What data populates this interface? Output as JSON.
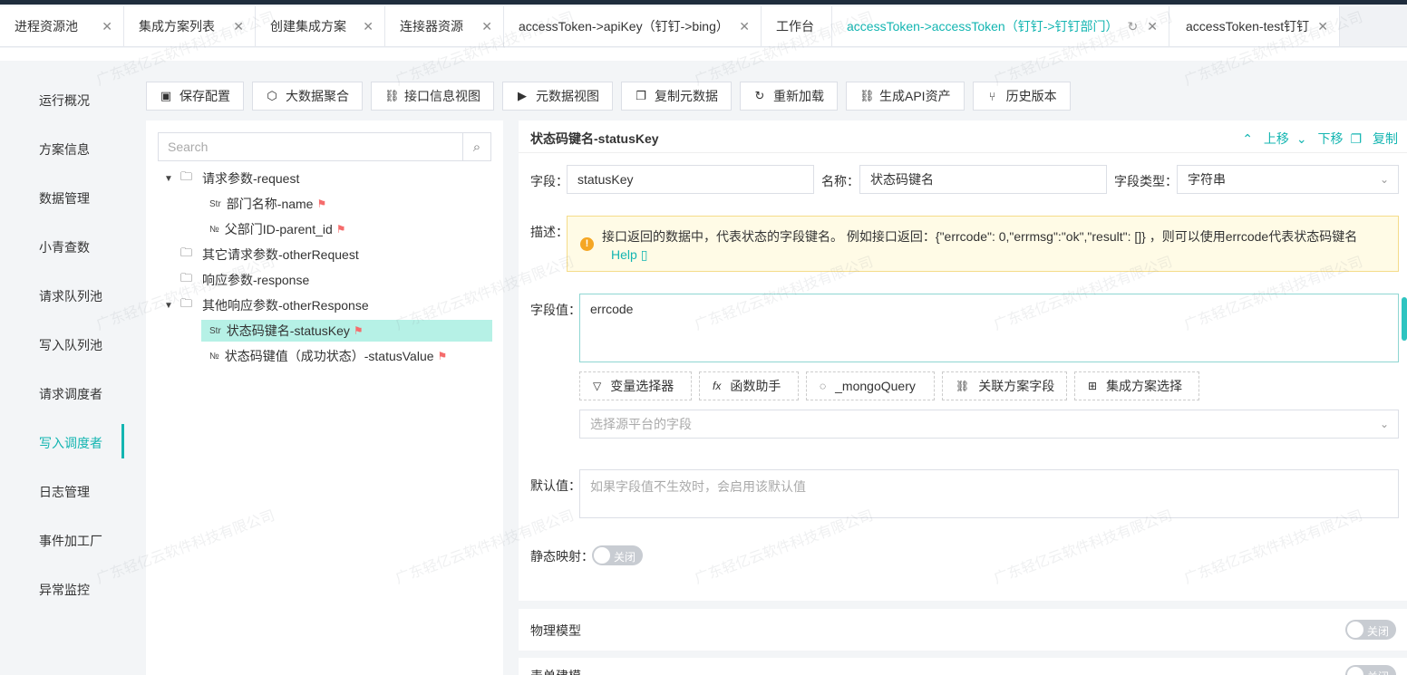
{
  "tabs": [
    {
      "label": "进程资源池",
      "active": false
    },
    {
      "label": "集成方案列表",
      "active": false
    },
    {
      "label": "创建集成方案",
      "active": false
    },
    {
      "label": "连接器资源",
      "active": false
    },
    {
      "label": "accessToken->apiKey（钉钉->bing）",
      "active": false
    },
    {
      "label": "工作台",
      "active": false
    },
    {
      "label": "accessToken->accessToken（钉钉->钉钉部门）",
      "active": true
    },
    {
      "label": "accessToken-test钉钉",
      "active": false
    }
  ],
  "sidebar": {
    "items": [
      "运行概况",
      "方案信息",
      "数据管理",
      "小青查数",
      "请求队列池",
      "写入队列池",
      "请求调度者",
      "写入调度者",
      "日志管理",
      "事件加工厂",
      "异常监控"
    ],
    "active": "写入调度者"
  },
  "toolbar": {
    "save": "保存配置",
    "bigdata": "大数据聚合",
    "api_view": "接口信息视图",
    "meta_view": "元数据视图",
    "copy_meta": "复制元数据",
    "reload": "重新加载",
    "gen_api": "生成API资产",
    "history": "历史版本"
  },
  "tree": {
    "search_placeholder": "Search",
    "nodes": {
      "request": "请求参数-request",
      "name": "部门名称-name",
      "parent_id": "父部门ID-parent_id",
      "other_request": "其它请求参数-otherRequest",
      "response": "响应参数-response",
      "other_response": "其他响应参数-otherResponse",
      "status_key": "状态码键名-statusKey",
      "status_value": "状态码键值（成功状态）-statusValue"
    },
    "type_str": "Str",
    "type_num": "№"
  },
  "form": {
    "title": "状态码键名-statusKey",
    "actions": {
      "up": "上移",
      "down": "下移",
      "copy": "复制"
    },
    "field_label": "字段：",
    "field_value": "statusKey",
    "name_label": "名称：",
    "name_value": "状态码键名",
    "type_label": "字段类型：",
    "type_value": "字符串",
    "desc_label": "描述：",
    "desc_text": "接口返回的数据中，代表状态的字段键名。 例如接口返回：{\"errcode\": 0,\"errmsg\":\"ok\",\"result\": []} ，则可以使用errcode代表状态码键名",
    "help": "Help",
    "value_label": "字段值：",
    "value_text": "errcode",
    "buttons": {
      "var": "变量选择器",
      "func": "函数助手",
      "mongo": "_mongoQuery",
      "link": "关联方案字段",
      "scheme": "集成方案选择"
    },
    "source_placeholder": "选择源平台的字段",
    "default_label": "默认值：",
    "default_placeholder": "如果字段值不生效时，会启用该默认值",
    "static_label": "静态映射：",
    "toggle_off": "关闭"
  },
  "sections": {
    "physical": "物理模型",
    "form_model": "表单建模"
  },
  "watermark": "广东轻亿云软件科技有限公司",
  "colors": {
    "accent": "#13b5b1",
    "flag": "#f56c6c",
    "selected": "#b6f1e6"
  }
}
